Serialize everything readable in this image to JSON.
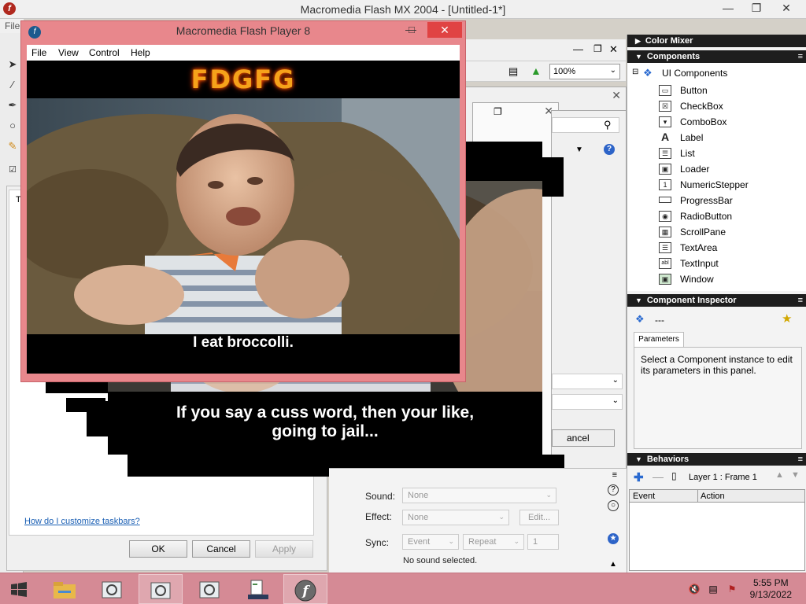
{
  "main_window": {
    "title": "Macromedia Flash MX 2004 - [Untitled-1*]",
    "menu_stub": "File"
  },
  "flash_player": {
    "title": "Macromedia Flash Player 8",
    "menu": [
      "File",
      "View",
      "Control",
      "Help"
    ],
    "banner_text": "FDGFG",
    "subtitle": "I eat broccolli."
  },
  "background_video": {
    "subtitle_line1": "If you say a cuss word, then your like,",
    "subtitle_line2": "going to jail..."
  },
  "doc_toolbar": {
    "zoom": "100%"
  },
  "taskbar_dialog": {
    "help_link": "How do I customize taskbars?",
    "ok": "OK",
    "cancel": "Cancel",
    "apply": "Apply",
    "partial_cancel": "ancel",
    "partial_t": "T"
  },
  "properties": {
    "sound_label": "Sound:",
    "sound_value": "None",
    "effect_label": "Effect:",
    "effect_value": "None",
    "edit_button": "Edit...",
    "sync_label": "Sync:",
    "sync_value": "Event",
    "repeat_value": "Repeat",
    "repeat_count": "1",
    "status": "No sound selected."
  },
  "panels": {
    "color_mixer": "Color Mixer",
    "components": "Components",
    "ui_components": "UI Components",
    "items": [
      "Button",
      "CheckBox",
      "ComboBox",
      "Label",
      "List",
      "Loader",
      "NumericStepper",
      "ProgressBar",
      "RadioButton",
      "ScrollPane",
      "TextArea",
      "TextInput",
      "Window"
    ],
    "inspector": "Component Inspector",
    "inspector_value": "---",
    "parameters_tab": "Parameters",
    "inspector_msg": "Select a Component instance to edit its parameters in this panel.",
    "behaviors": "Behaviors",
    "behaviors_target": "Layer 1 : Frame 1",
    "col_event": "Event",
    "col_action": "Action"
  },
  "taskbar": {
    "time": "5:55 PM",
    "date": "9/13/2022"
  }
}
